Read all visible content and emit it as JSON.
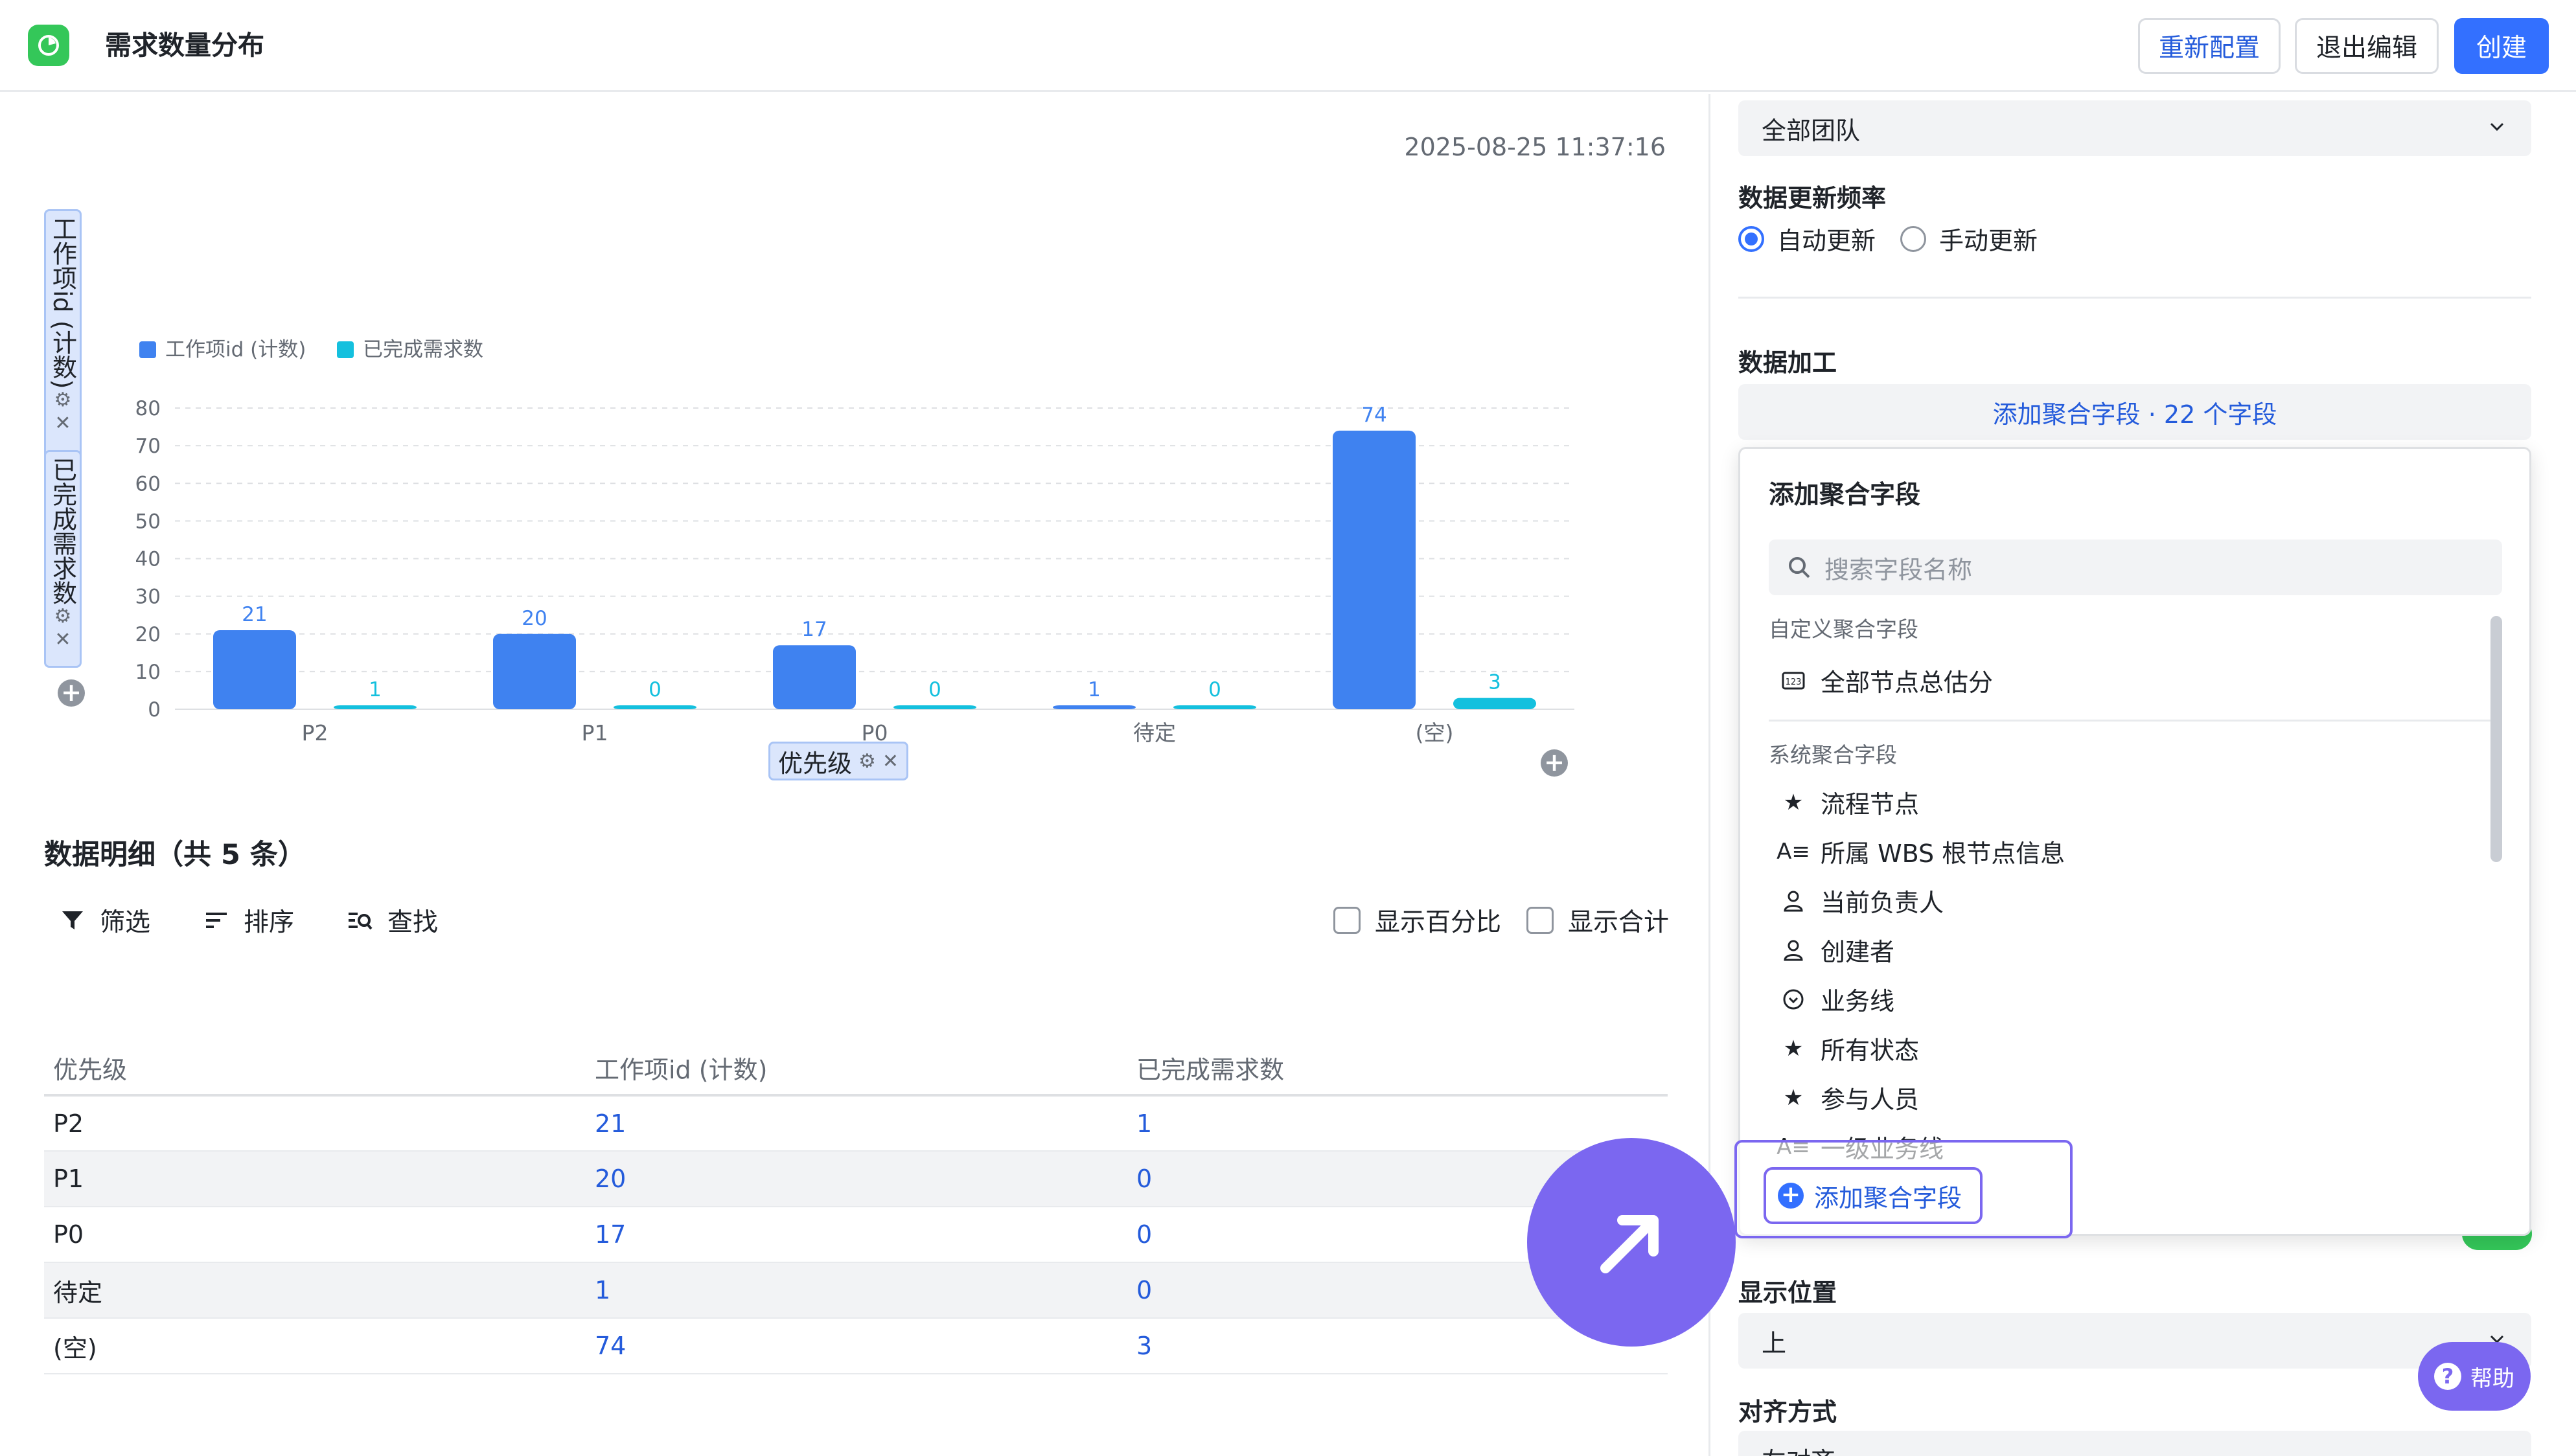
{
  "header": {
    "title": "需求数量分布",
    "btn_reconfig": "重新配置",
    "btn_exit": "退出编辑",
    "btn_create": "创建"
  },
  "chart_panel": {
    "timestamp": "2025-08-25 11:37:16",
    "y_chip_1": "工作项id (计数)",
    "y_chip_2": "已完成需求数",
    "x_chip": "优先级",
    "gear": "⚙",
    "close": "✕",
    "plus": "+"
  },
  "chart_data": {
    "type": "bar",
    "categories": [
      "P2",
      "P1",
      "P0",
      "待定",
      "(空)"
    ],
    "series": [
      {
        "name": "工作项id (计数)",
        "values": [
          21,
          20,
          17,
          1,
          74
        ],
        "color": "#3f82f0"
      },
      {
        "name": "已完成需求数",
        "values": [
          1,
          0,
          0,
          0,
          3
        ],
        "color": "#14c0de"
      }
    ],
    "ylim": [
      0,
      80
    ],
    "yticks": [
      "0",
      "10",
      "20",
      "30",
      "40",
      "50",
      "60",
      "70",
      "80"
    ],
    "legend": "top-left",
    "grid": true
  },
  "details": {
    "title": "数据明细（共 5 条）",
    "toolbar": {
      "filter": "筛选",
      "sort": "排序",
      "find": "查找"
    },
    "show_percent": "显示百分比",
    "show_total": "显示合计",
    "columns": [
      "优先级",
      "工作项id (计数)",
      "已完成需求数"
    ],
    "rows": [
      [
        "P2",
        "21",
        "1"
      ],
      [
        "P1",
        "20",
        "0"
      ],
      [
        "P0",
        "17",
        "0"
      ],
      [
        "待定",
        "1",
        "0"
      ],
      [
        "(空)",
        "74",
        "3"
      ]
    ]
  },
  "right_panel": {
    "team_select": "全部团队",
    "update_freq_label": "数据更新频率",
    "auto_update": "自动更新",
    "manual_update": "手动更新",
    "processing_label": "数据加工",
    "agg_button": "添加聚合字段 · 22 个字段",
    "position_label": "显示位置",
    "position_value": "上",
    "align_label": "对齐方式",
    "align_value": "左对齐",
    "help": "帮助"
  },
  "popup": {
    "title": "添加聚合字段",
    "search_placeholder": "搜索字段名称",
    "custom_section": "自定义聚合字段",
    "custom_fields": [
      "全部节点总估分"
    ],
    "system_section": "系统聚合字段",
    "system_fields": [
      {
        "label": "流程节点",
        "icon": "node-icon"
      },
      {
        "label": "所属 WBS 根节点信息",
        "icon": "text-icon"
      },
      {
        "label": "当前负责人",
        "icon": "user-icon"
      },
      {
        "label": "创建者",
        "icon": "user-icon"
      },
      {
        "label": "业务线",
        "icon": "option-icon"
      },
      {
        "label": "所有状态",
        "icon": "node-icon"
      },
      {
        "label": "参与人员",
        "icon": "node-icon"
      },
      {
        "label": "一级业务线",
        "icon": "text-icon"
      }
    ],
    "add_button": "添加聚合字段"
  }
}
